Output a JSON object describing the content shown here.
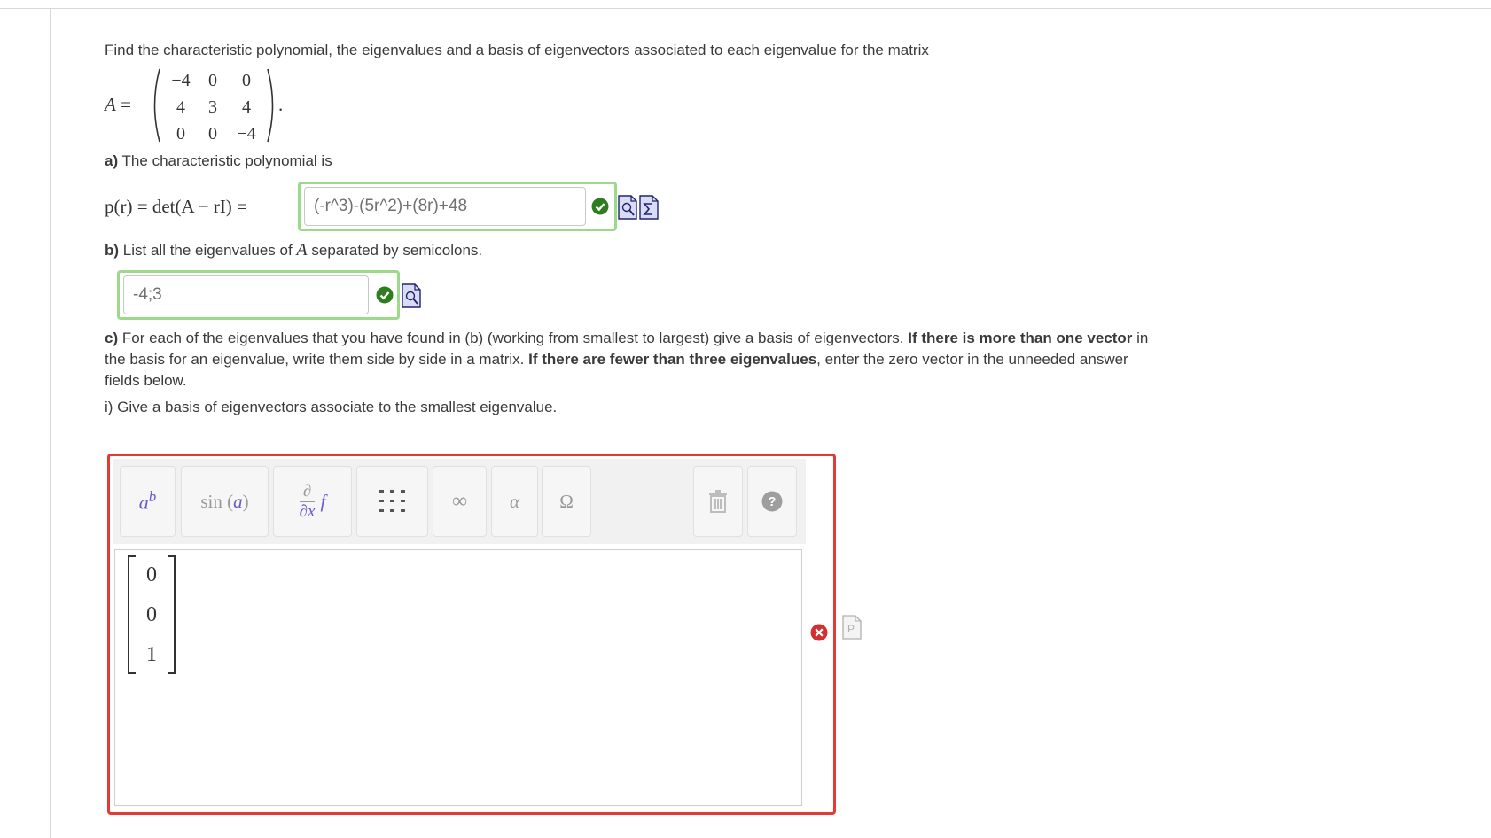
{
  "problem": {
    "intro": "Find the characteristic polynomial, the eigenvalues and a basis of eigenvectors associated to each eigenvalue for the matrix",
    "matrix_var": "A",
    "matrix_rows": [
      [
        "−4",
        "0",
        "0"
      ],
      [
        "4",
        "3",
        "4"
      ],
      [
        "0",
        "0",
        "−4"
      ]
    ]
  },
  "part_a": {
    "label": "a)",
    "text": "The characteristic polynomial is",
    "formula": "p(r) = det(A − rI) =",
    "answer": "(-r^3)-(5r^2)+(8r)+48",
    "status": "correct"
  },
  "part_b": {
    "label": "b)",
    "text_before": "List all the eigenvalues of",
    "text_var": "A",
    "text_after": "separated by semicolons.",
    "answer": "-4;3",
    "status": "correct"
  },
  "part_c": {
    "label": "c)",
    "seg1": "For each of the eigenvalues that you have found in (b) (working from smallest to largest) give a basis of eigenvectors.",
    "bold1": "If there is more than one vector",
    "seg2": "in",
    "line2a": "the basis for an eigenvalue, write them side by side in a matrix.",
    "bold2": "If there are fewer than three eigenvalues",
    "line2b": ", enter the zero vector in the unneeded answer",
    "line3": "fields below.",
    "sub_i": "i) Give a basis of eigenvectors associate to the smallest eigenvalue.",
    "answer_vector": [
      "0",
      "0",
      "1"
    ],
    "status": "incorrect"
  },
  "toolbar": {
    "buttons": [
      {
        "name": "superscript-button",
        "label": "ab"
      },
      {
        "name": "functions-button",
        "label": "sin (a)"
      },
      {
        "name": "calculus-button",
        "label": "∂/∂x f"
      },
      {
        "name": "matrix-button",
        "label": "matrix"
      },
      {
        "name": "infinity-button",
        "label": "∞"
      },
      {
        "name": "greek-button",
        "label": "α"
      },
      {
        "name": "symbols-button",
        "label": "Ω"
      },
      {
        "name": "trash-button",
        "label": "trash"
      },
      {
        "name": "help-button",
        "label": "?"
      }
    ]
  },
  "colors": {
    "correct": "#9cd98a",
    "incorrect": "#e53935",
    "check_fill": "#2e7d1e",
    "error_fill": "#d32f2f",
    "toolbar_accent": "#6a5acd"
  }
}
